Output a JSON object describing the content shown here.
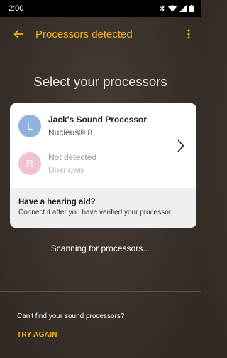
{
  "status_bar": {
    "time": "2:00"
  },
  "app_bar": {
    "title": "Processors detected",
    "back_icon": "arrow-left-icon",
    "menu_icon": "more-vertical-icon",
    "accent_color": "#f5b40a"
  },
  "main": {
    "heading": "Select your processors",
    "processors": [
      {
        "initial": "L",
        "name": "Jack's Sound Processor",
        "model": "Nucleus® 8",
        "avatar_color": "#8fb2de"
      },
      {
        "initial": "R",
        "name": "Not detected",
        "model": "Unknown",
        "avatar_color": "#f3c3cd"
      }
    ],
    "hearing_aid": {
      "title": "Have a hearing aid?",
      "subtitle": "Connect it after you have verified your processor"
    },
    "scanning_text": "Scanning for processors..."
  },
  "footer": {
    "question": "Can't find your sound processors?",
    "try_again_label": "TRY AGAIN"
  }
}
